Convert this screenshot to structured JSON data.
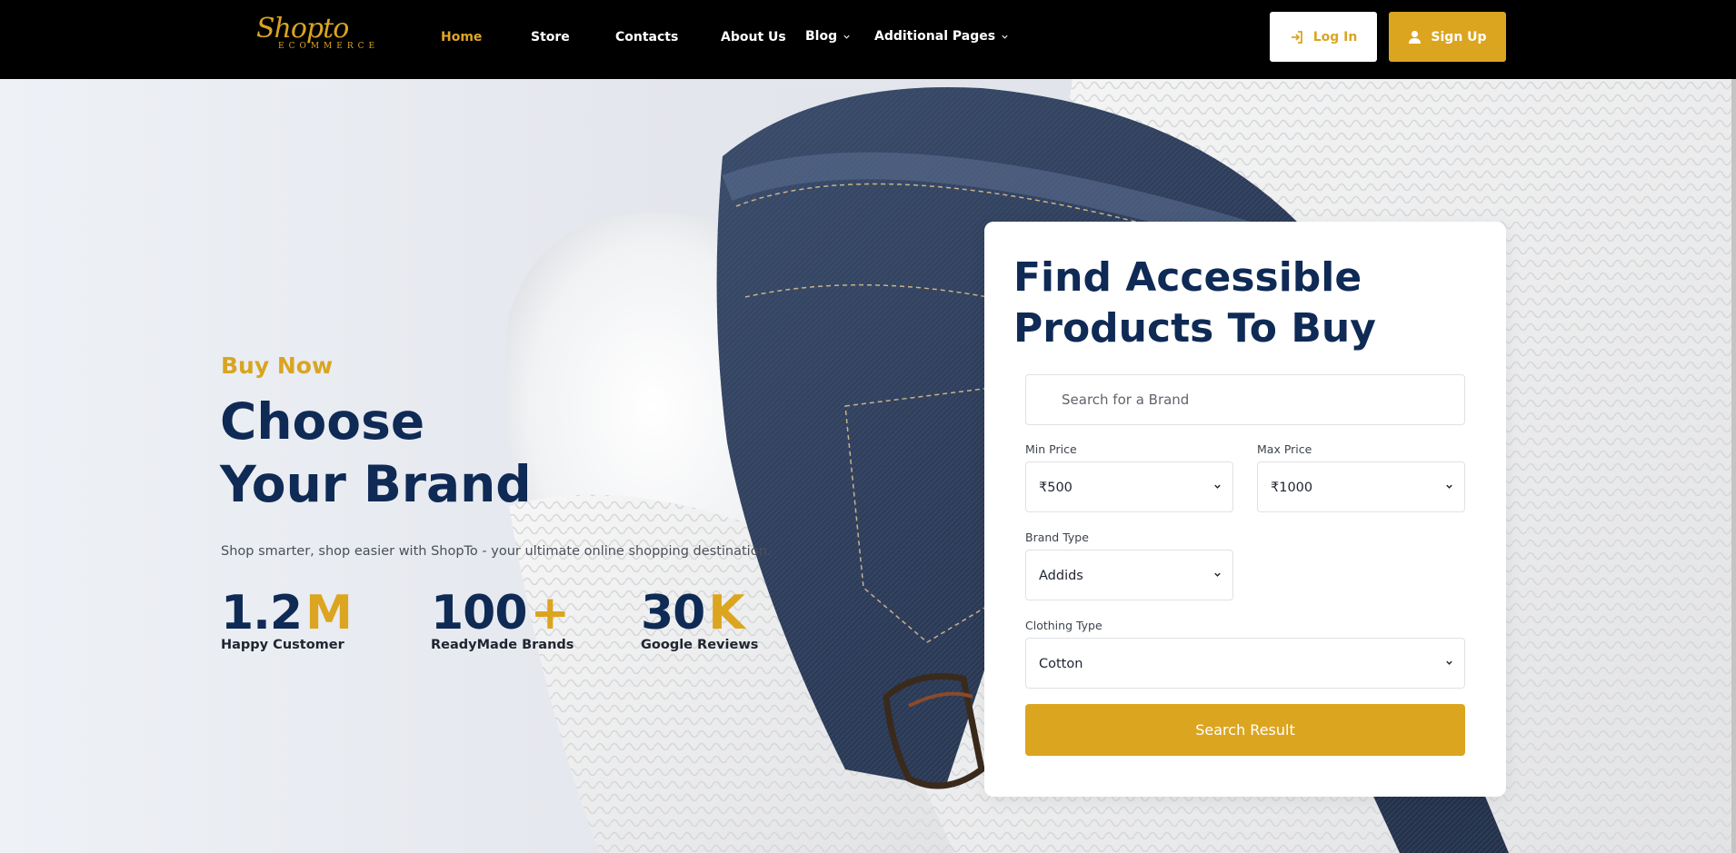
{
  "brand": {
    "logo_script": "Shopto",
    "logo_sub": "ECOMMERCE"
  },
  "nav": {
    "items": [
      {
        "label": "Home",
        "active": true,
        "dropdown": false
      },
      {
        "label": "Store",
        "active": false,
        "dropdown": false
      },
      {
        "label": "Contacts",
        "active": false,
        "dropdown": false
      },
      {
        "label": "About Us",
        "active": false,
        "dropdown": false
      },
      {
        "label": "Blog",
        "active": false,
        "dropdown": true
      },
      {
        "label": "Additional Pages",
        "active": false,
        "dropdown": true
      }
    ],
    "login_label": "Log In",
    "login_icon": "sign-in-icon",
    "signup_label": "Sign Up",
    "signup_icon": "user-icon"
  },
  "hero": {
    "kicker": "Buy Now",
    "headline_line1": "Choose",
    "headline_line2": "Your Brand",
    "tagline": "Shop smarter, shop easier with ShopTo - your ultimate online shopping destination.",
    "stats": [
      {
        "value": "1.2",
        "suffix": "M",
        "label": "Happy Customer"
      },
      {
        "value": "100",
        "suffix": "+",
        "label": "ReadyMade Brands"
      },
      {
        "value": "30",
        "suffix": "K",
        "label": "Google Reviews"
      }
    ]
  },
  "search_card": {
    "title": "Find Accessible Products To Buy",
    "search_placeholder": "Search for a Brand",
    "min_price_label": "Min Price",
    "min_price_value": "₹500",
    "max_price_label": "Max Price",
    "max_price_value": "₹1000",
    "brand_type_label": "Brand Type",
    "brand_type_value": "Addids",
    "clothing_type_label": "Clothing Type",
    "clothing_type_value": "Cotton",
    "submit_label": "Search Result"
  },
  "colors": {
    "accent": "#dca520",
    "navy": "#0e2a55",
    "nav_bg": "#000000",
    "card_bg": "#ffffff"
  }
}
